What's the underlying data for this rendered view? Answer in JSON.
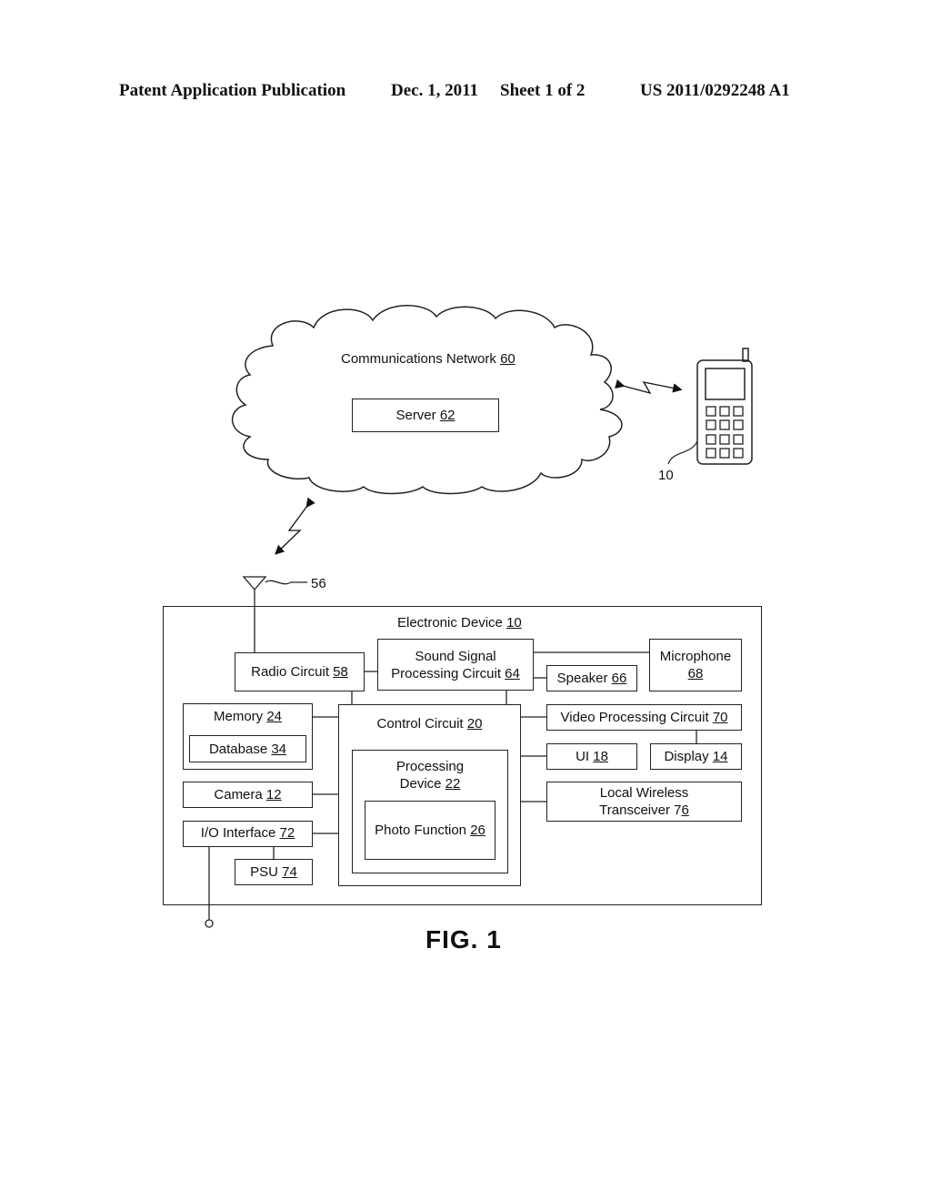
{
  "header": {
    "publication": "Patent Application Publication",
    "date": "Dec. 1, 2011",
    "sheet": "Sheet 1 of 2",
    "number": "US 2011/0292248 A1"
  },
  "network": {
    "label": "Communications Network",
    "ref": "60",
    "server": {
      "label": "Server",
      "ref": "62"
    }
  },
  "phone": {
    "ref": "10"
  },
  "antenna": {
    "ref": "56"
  },
  "device": {
    "label": "Electronic Device",
    "ref": "10",
    "blocks": {
      "radio": {
        "label": "Radio Circuit",
        "ref": "58"
      },
      "sound_line1": "Sound Signal",
      "sound_line2": "Processing Circuit",
      "sound_ref": "64",
      "speaker": {
        "label": "Speaker",
        "ref": "66"
      },
      "microphone": {
        "label": "Microphone",
        "ref": "68"
      },
      "memory": {
        "label": "Memory",
        "ref": "24"
      },
      "database": {
        "label": "Database",
        "ref": "34"
      },
      "control": {
        "label": "Control Circuit",
        "ref": "20"
      },
      "processing_line1": "Processing",
      "processing_line2": "Device",
      "processing_ref": "22",
      "photo": {
        "label": "Photo Function",
        "ref": "26"
      },
      "camera": {
        "label": "Camera",
        "ref": "12"
      },
      "io": {
        "label": "I/O Interface",
        "ref": "72"
      },
      "psu": {
        "label": "PSU",
        "ref": "74"
      },
      "video": {
        "label": "Video Processing Circuit",
        "ref": "70"
      },
      "ui": {
        "label": "UI",
        "ref": "18"
      },
      "display": {
        "label": "Display",
        "ref": "14"
      },
      "wireless_line1": "Local Wireless",
      "wireless_line2": "Transceiver 7",
      "wireless_ref_tail": "6"
    }
  },
  "figure_label": "FIG. 1"
}
